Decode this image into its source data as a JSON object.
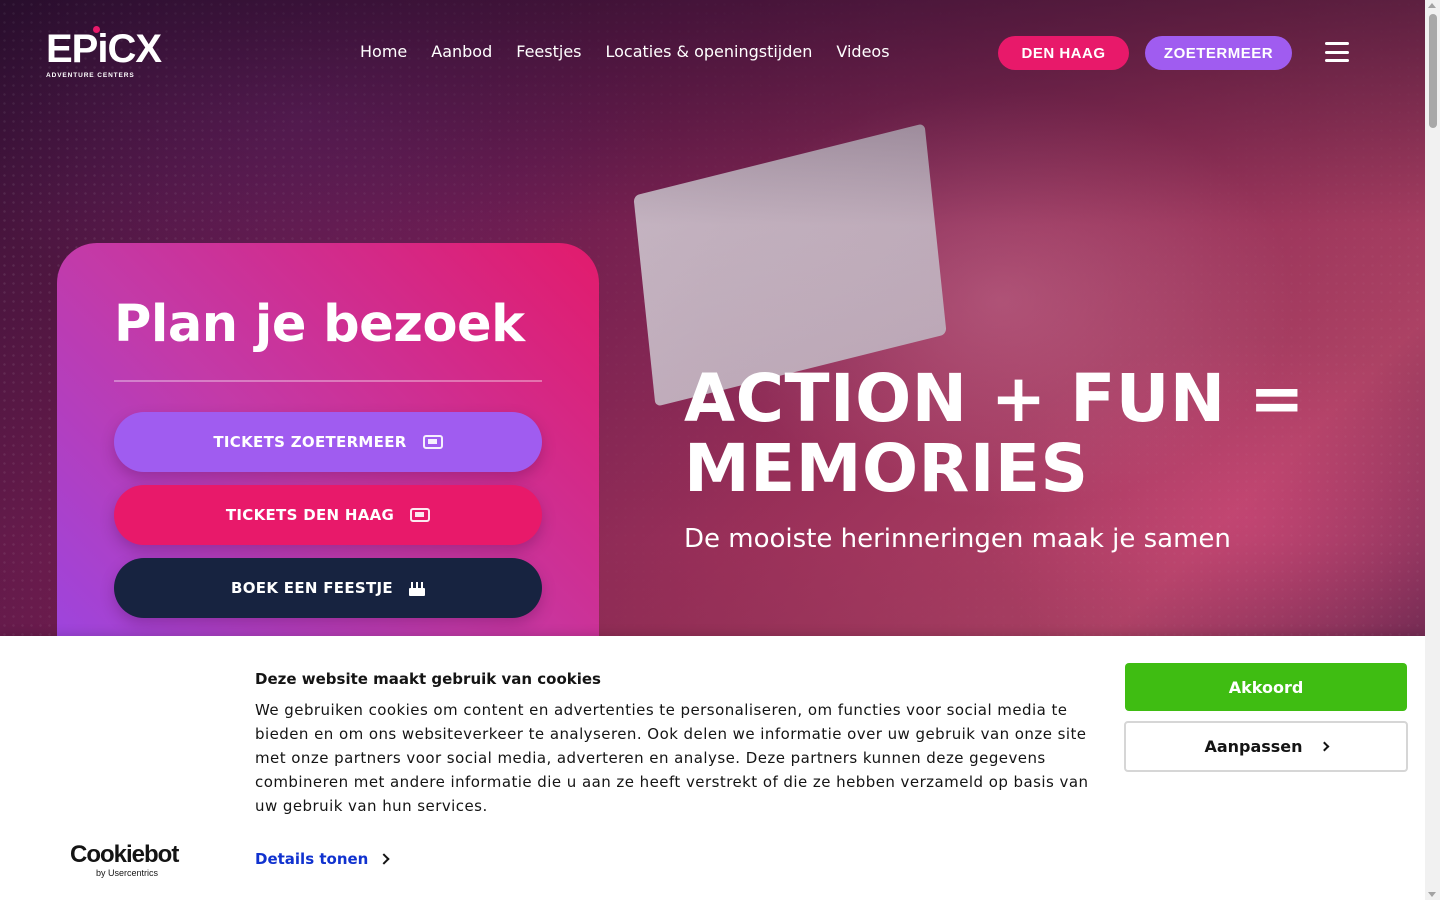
{
  "brand": {
    "logo_word": "EPiCX",
    "logo_sub": "ADVENTURE CENTERS",
    "accent_pink": "#e8196a",
    "accent_purple": "#a05cf0",
    "navy": "#172340"
  },
  "nav": {
    "items": [
      "Home",
      "Aanbod",
      "Feestjes",
      "Locaties & openingstijden",
      "Videos"
    ]
  },
  "header": {
    "pill_denhaag": "DEN HAAG",
    "pill_zoetermeer": "ZOETERMEER",
    "menu_icon": "hamburger-icon"
  },
  "plan": {
    "title": "Plan je bezoek",
    "buttons": [
      {
        "label": "TICKETS ZOETERMEER",
        "icon": "ticket-icon"
      },
      {
        "label": "TICKETS DEN HAAG",
        "icon": "ticket-icon"
      },
      {
        "label": "BOEK EEN FEESTJE",
        "icon": "cake-icon"
      }
    ]
  },
  "hero": {
    "title_line1": "ACTION + FUN =",
    "title_line2": "MEMORIES",
    "subtitle": "De mooiste herinneringen maak je samen"
  },
  "cookie": {
    "title": "Deze website maakt gebruik van cookies",
    "text": "We gebruiken cookies om content en advertenties te personaliseren, om functies voor social media te bieden en om ons websiteverkeer te analyseren. Ook delen we informatie over uw gebruik van onze site met onze partners voor social media, adverteren en analyse. Deze partners kunnen deze gegevens combineren met andere informatie die u aan ze heeft verstrekt of die ze hebben verzameld op basis van uw gebruik van hun services.",
    "details_label": "Details tonen",
    "accept_label": "Akkoord",
    "customize_label": "Aanpassen",
    "provider_word": "Cookiebot",
    "provider_sub": "by Usercentrics",
    "accept_color": "#3fbd12",
    "link_color": "#1032cf"
  }
}
